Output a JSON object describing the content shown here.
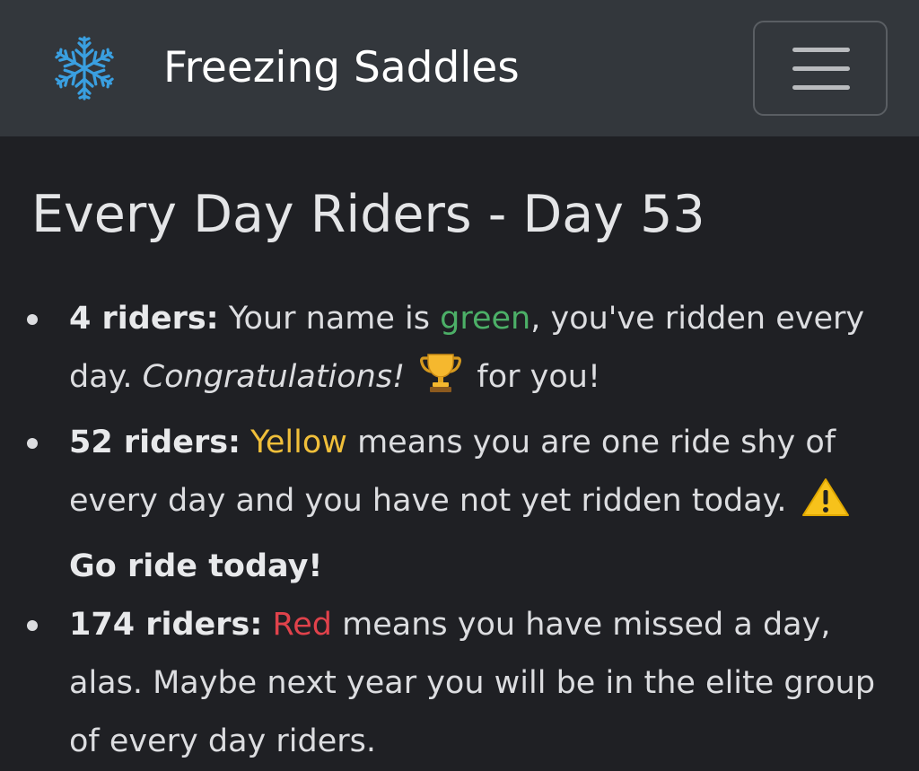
{
  "navbar": {
    "brand_name": "Freezing Saddles",
    "brand_icon": "snowflake-icon",
    "menu_icon": "hamburger-menu-icon"
  },
  "page": {
    "title": "Every Day Riders - Day 53"
  },
  "legend": {
    "green": {
      "count_label": "4 riders:",
      "text_before": "Your name is",
      "color_word": "green",
      "text_after": ", you've ridden every day.",
      "emphasis": "Congratulations!",
      "icon": "trophy-icon",
      "text_end": "for you!"
    },
    "yellow": {
      "count_label": "52 riders:",
      "color_word": "Yellow",
      "text_after": "means you are one ride shy of every day and you have not yet ridden today.",
      "icon": "warning-icon",
      "call_to_action": "Go ride today!"
    },
    "red": {
      "count_label": "174 riders:",
      "color_word": "Red",
      "text_after": "means you have missed a day, alas. Maybe next year you will be in the elite group of every day riders."
    }
  },
  "colors": {
    "navbar_bg": "#33373c",
    "page_bg": "#1f2024",
    "green": "#4caf67",
    "yellow": "#f0bf3a",
    "red": "#e0424b",
    "snowflake": "#3a9fe0"
  }
}
